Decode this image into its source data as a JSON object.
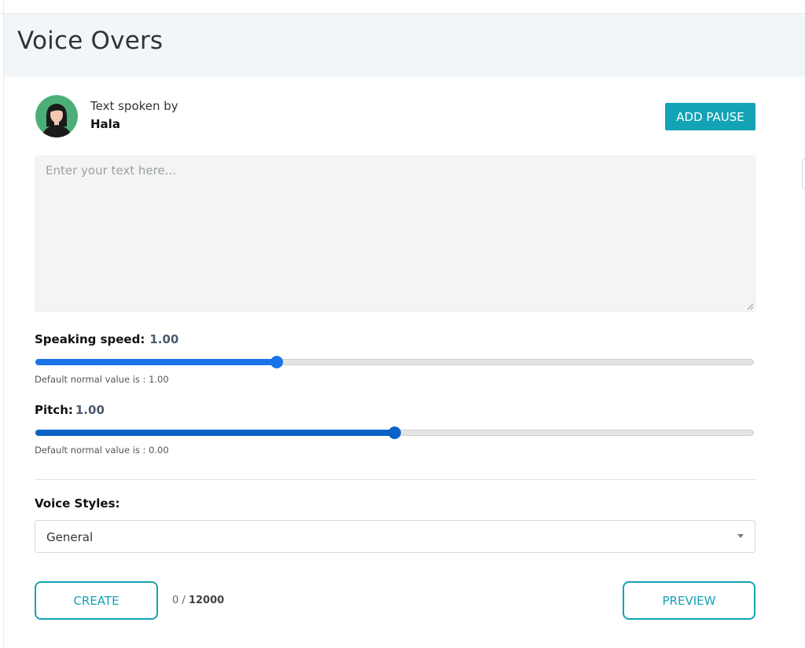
{
  "header": {
    "title": "Voice Overs"
  },
  "speaker": {
    "label": "Text spoken by",
    "name": "Hala",
    "avatar_icon": "female-avatar-icon"
  },
  "toolbar": {
    "add_pause_label": "ADD PAUSE"
  },
  "text_input": {
    "placeholder": "Enter your text here...",
    "value": ""
  },
  "speed": {
    "label": "Speaking speed:",
    "value": "1.00",
    "hint": "Default normal value is : 1.00",
    "position_percent": 33.6,
    "color": "#1a73e8"
  },
  "pitch": {
    "label": "Pitch:",
    "value": "1.00",
    "hint": "Default normal value is : 0.00",
    "position_percent": 50,
    "color": "#0a62c7"
  },
  "voice_styles": {
    "label": "Voice Styles:",
    "selected": "General"
  },
  "actions": {
    "create_label": "CREATE",
    "preview_label": "PREVIEW"
  },
  "counter": {
    "current": "0",
    "separator": " / ",
    "max": "12000"
  },
  "colors": {
    "accent": "#13a3b5",
    "header_bg": "#f3f6f8"
  }
}
